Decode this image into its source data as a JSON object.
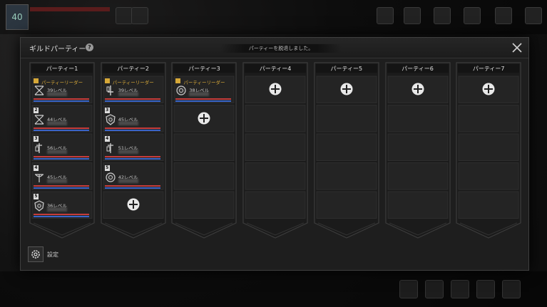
{
  "hud": {
    "level": "40"
  },
  "dialog": {
    "title": "ギルドパーティー",
    "notice": "パーティーを脱退しました。",
    "settings_label": "設定"
  },
  "leader_label": "パーティーリーダー",
  "parties": [
    {
      "title": "パーティー1",
      "members": [
        {
          "num": "1",
          "leader": true,
          "level": "39レベル",
          "class_icon": "bow-icon"
        },
        {
          "num": "2",
          "leader": false,
          "level": "44レベル",
          "class_icon": "bow-icon"
        },
        {
          "num": "3",
          "leader": false,
          "level": "56レベル",
          "class_icon": "staff-icon"
        },
        {
          "num": "4",
          "leader": false,
          "level": "45レベル",
          "class_icon": "crossbow-icon"
        },
        {
          "num": "5",
          "leader": false,
          "level": "36レベル",
          "class_icon": "shield-icon"
        }
      ]
    },
    {
      "title": "パーティー2",
      "members": [
        {
          "num": "1",
          "leader": true,
          "level": "39レベル",
          "class_icon": "sword-icon"
        },
        {
          "num": "3",
          "leader": false,
          "level": "45レベル",
          "class_icon": "shield-icon"
        },
        {
          "num": "4",
          "leader": false,
          "level": "51レベル",
          "class_icon": "staff-icon"
        },
        {
          "num": "5",
          "leader": false,
          "level": "42レベル",
          "class_icon": "orb-icon"
        }
      ]
    },
    {
      "title": "パーティー3",
      "members": [
        {
          "num": "",
          "leader": true,
          "level": "38レベル",
          "class_icon": "orb-icon"
        }
      ]
    },
    {
      "title": "パーティー4",
      "members": []
    },
    {
      "title": "パーティー5",
      "members": []
    },
    {
      "title": "パーティー6",
      "members": []
    },
    {
      "title": "パーティー7",
      "members": []
    }
  ]
}
